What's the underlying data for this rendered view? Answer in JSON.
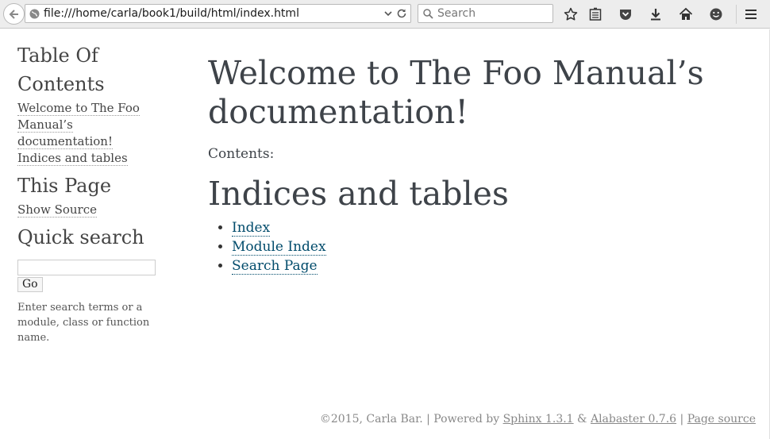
{
  "browser": {
    "url": "file:///home/carla/book1/build/html/index.html",
    "search_placeholder": "Search",
    "icons": [
      "back-icon",
      "globe-icon",
      "dropdown-icon",
      "reload-icon",
      "search-icon",
      "bookmark-star-icon",
      "reading-list-icon",
      "pocket-icon",
      "download-icon",
      "home-icon",
      "smiley-icon",
      "menu-icon"
    ]
  },
  "sidebar": {
    "toc_heading": "Table Of Contents",
    "toc_links": [
      "Welcome to The Foo Manual’s documentation!",
      "Indices and tables"
    ],
    "this_page_heading": "This Page",
    "show_source": "Show Source",
    "quick_search_heading": "Quick search",
    "go_label": "Go",
    "search_help": "Enter search terms or a module, class or function name."
  },
  "main": {
    "title": "Welcome to The Foo Manual’s documentation!",
    "contents_label": "Contents:",
    "section_heading": "Indices and tables",
    "links": [
      "Index",
      "Module Index",
      "Search Page"
    ]
  },
  "footer": {
    "copyright": "©2015, Carla Bar. | Powered by ",
    "sphinx": "Sphinx 1.3.1",
    "amp": " & ",
    "alabaster": "Alabaster 0.7.6",
    "sep": " | ",
    "page_source": "Page source"
  },
  "colors": {
    "link": "#004b6b",
    "text": "#3e4349"
  }
}
